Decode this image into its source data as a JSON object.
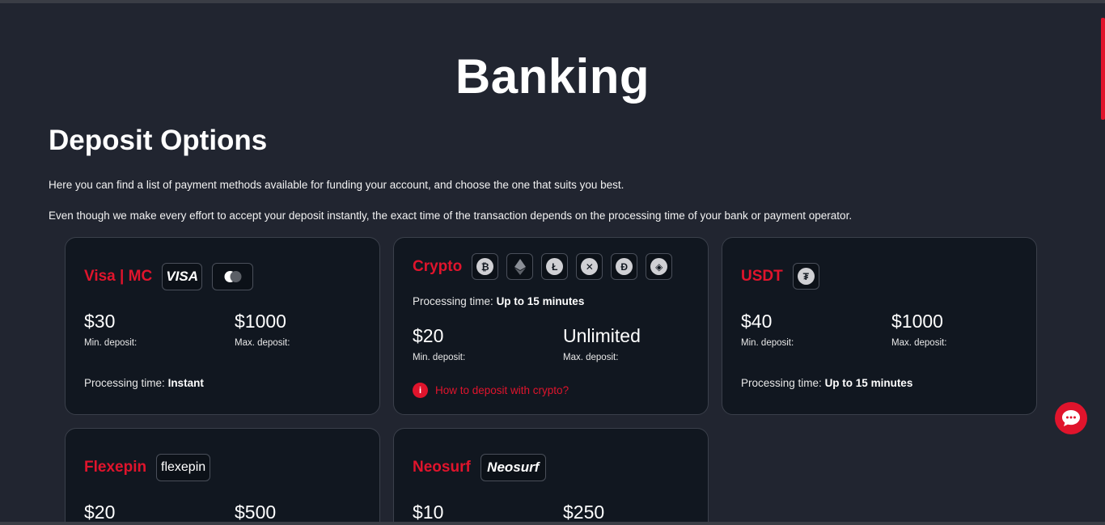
{
  "page": {
    "title": "Banking"
  },
  "section": {
    "title": "Deposit Options",
    "intro": "Here you can find a list of payment methods available for funding your account, and choose the one that suits you best.",
    "note": "Even though we make every effort to accept your deposit instantly, the exact time of the transaction depends on the processing time of your bank or payment operator."
  },
  "labels": {
    "min": "Min. deposit:",
    "max": "Max. deposit:",
    "processing": "Processing time:"
  },
  "cards": {
    "visa": {
      "name": "Visa | MC",
      "logo": "VISA",
      "min": "$30",
      "max": "$1000",
      "processing": "Instant"
    },
    "crypto": {
      "name": "Crypto",
      "min": "$20",
      "max": "Unlimited",
      "processing": "Up to 15 minutes",
      "help": "How to deposit with crypto?",
      "coins": [
        "bitcoin-icon",
        "ethereum-icon",
        "litecoin-icon",
        "ripple-icon",
        "dogecoin-icon",
        "bnb-icon"
      ]
    },
    "usdt": {
      "name": "USDT",
      "min": "$40",
      "max": "$1000",
      "processing": "Up to 15 minutes"
    },
    "flexepin": {
      "name": "Flexepin",
      "logo": "flexepin",
      "min": "$20",
      "max": "$500"
    },
    "neosurf": {
      "name": "Neosurf",
      "logo": "Neosurf",
      "min": "$10",
      "max": "$250"
    }
  },
  "colors": {
    "accent": "#e0142c",
    "background": "#212530",
    "card": "#111720"
  }
}
